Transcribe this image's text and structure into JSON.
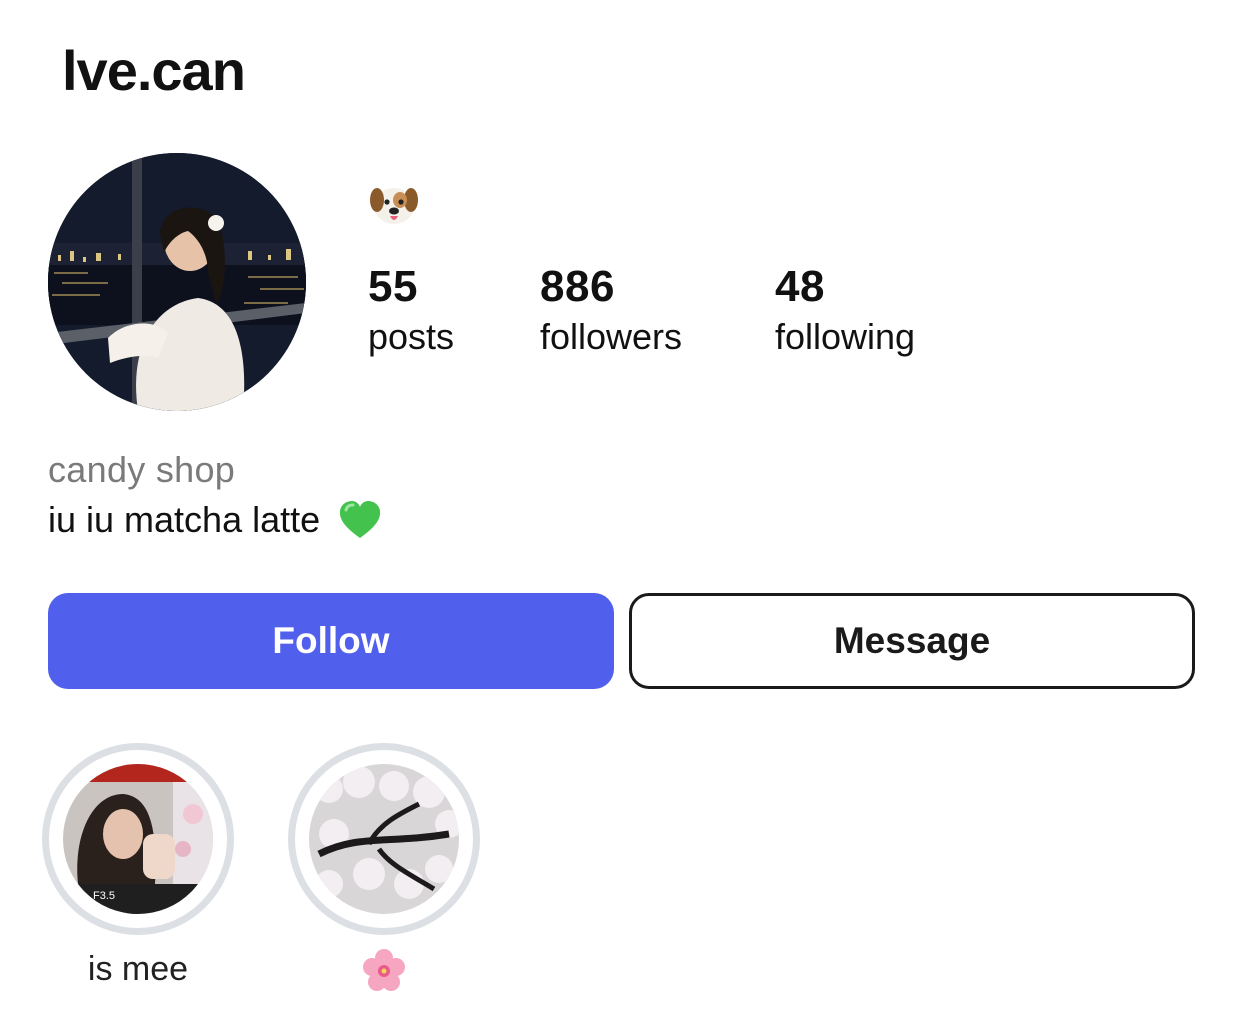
{
  "profile": {
    "username": "lve.can",
    "avatar_alt": "profile photo"
  },
  "header_emoji": "dog-face",
  "stats": [
    {
      "value": "55",
      "label": "posts"
    },
    {
      "value": "886",
      "label": "followers"
    },
    {
      "value": "48",
      "label": "following"
    }
  ],
  "bio": {
    "name": "candy shop",
    "text": "iu iu matcha latte",
    "emoji": "green-heart"
  },
  "actions": {
    "follow_label": "Follow",
    "message_label": "Message"
  },
  "highlights": [
    {
      "label": "is mee",
      "icon": "photo-thumbnail"
    },
    {
      "label": "",
      "icon": "cherry-blossom"
    }
  ],
  "colors": {
    "follow_button": "#5060ec",
    "highlight_ring": "#dcdfe4",
    "bio_name": "#7a7a7a"
  }
}
